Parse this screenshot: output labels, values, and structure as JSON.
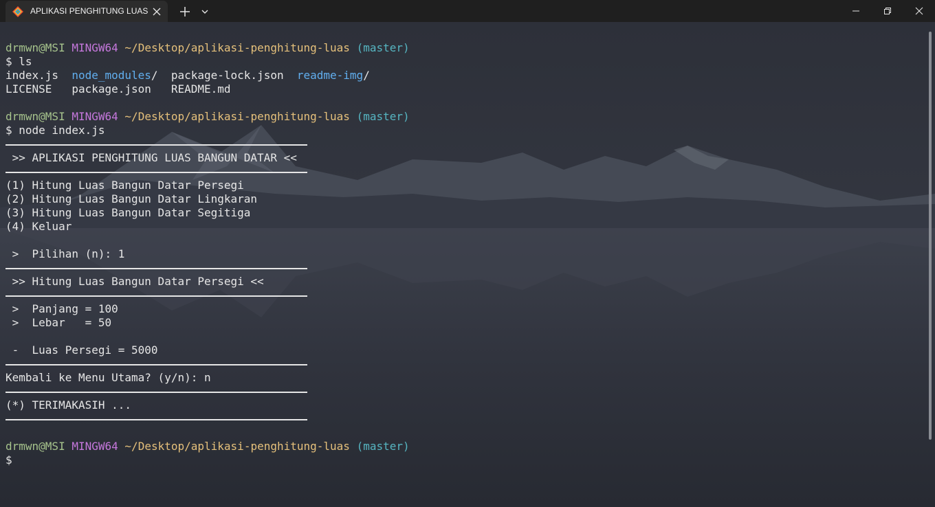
{
  "window": {
    "tab_title": "APLIKASI PENGHITUNG LUAS"
  },
  "icons": {
    "tab": "git-bash-icon",
    "tab_close": "close-icon",
    "new_tab": "plus-icon",
    "dropdown": "chevron-down-icon",
    "minimize": "minimize-icon",
    "maximize": "restore-icon",
    "close": "close-icon"
  },
  "colors": {
    "user": "#a6c38c",
    "host": "#c678dd",
    "path": "#e5c07b",
    "branch": "#56b6c2",
    "directory": "#61afef",
    "text": "#e6e6e6",
    "titlebar": "#1f1f1f"
  },
  "prompt": {
    "user": "drmwn@MSI",
    "host": "MINGW64",
    "path": "~/Desktop/aplikasi-penghitung-luas",
    "branch": "(master)"
  },
  "session": {
    "cmd_ls": "$ ls",
    "ls_row1": {
      "c1": "index.js",
      "c2": "node_modules",
      "c2_suffix": "/",
      "c3": "package-lock.json",
      "c4": "readme-img",
      "c4_suffix": "/"
    },
    "ls_row2": {
      "c1": "LICENSE",
      "c2": "package.json",
      "c3": "README.md"
    },
    "cmd_node": "$ node index.js",
    "app_header": " >> APLIKASI PENGHITUNG LUAS BANGUN DATAR <<",
    "menu": [
      "(1) Hitung Luas Bangun Datar Persegi",
      "(2) Hitung Luas Bangun Datar Lingkaran",
      "(3) Hitung Luas Bangun Datar Segitiga",
      "(4) Keluar"
    ],
    "choice": " >  Pilihan (n): 1",
    "sub_header": " >> Hitung Luas Bangun Datar Persegi <<",
    "input_panjang": " >  Panjang = 100",
    "input_lebar": " >  Lebar   = 50",
    "result": " -  Luas Persegi = 5000",
    "back_prompt": "Kembali ke Menu Utama? (y/n): n",
    "thanks": "(*) TERIMAKASIH ...",
    "final_prompt": "$"
  }
}
